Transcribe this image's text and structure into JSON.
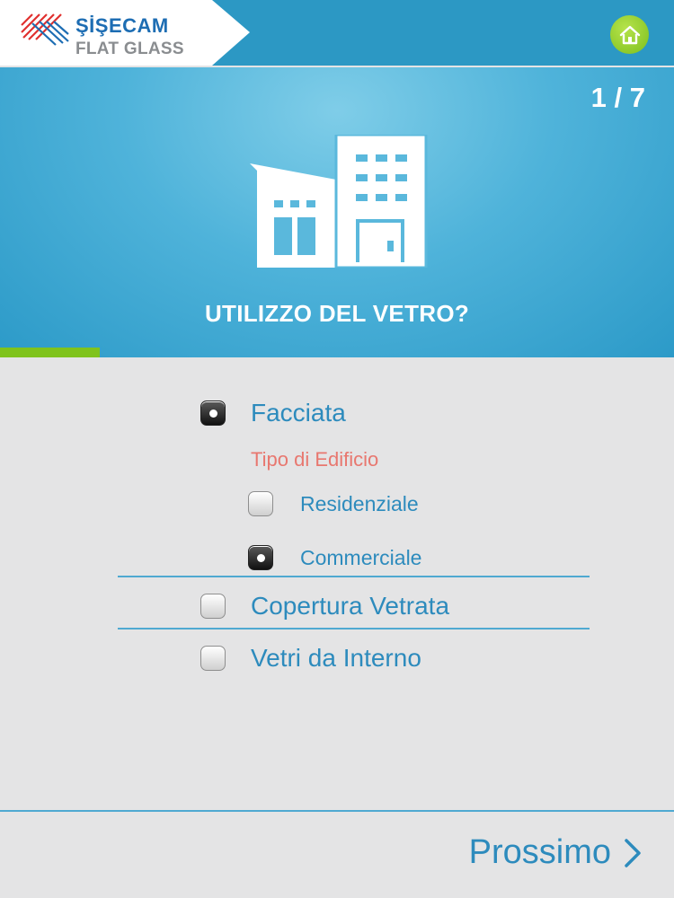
{
  "brand": {
    "name": "ŞİŞECAM",
    "subtitle": "FLAT GLASS"
  },
  "header": {
    "home_icon": "home-icon"
  },
  "hero": {
    "step": "1 / 7",
    "illustration": "building-icon",
    "question": "UTILIZZO DEL VETRO?",
    "progress_fraction": 0.1428
  },
  "options": [
    {
      "label": "Facciata",
      "checked": true
    },
    {
      "label": "Copertura Vetrata",
      "checked": false
    },
    {
      "label": "Vetri da Interno",
      "checked": false
    }
  ],
  "building_type": {
    "heading": "Tipo di Edificio",
    "options": [
      {
        "label": "Residenziale",
        "checked": false
      },
      {
        "label": "Commerciale",
        "checked": true
      }
    ]
  },
  "footer": {
    "next_label": "Prossimo",
    "next_icon": "chevron-right-icon"
  },
  "colors": {
    "primary": "#2c98c4",
    "accent": "#7fc31c",
    "text": "#2d8bbd",
    "subheading": "#e8776f",
    "background": "#e4e4e5"
  }
}
